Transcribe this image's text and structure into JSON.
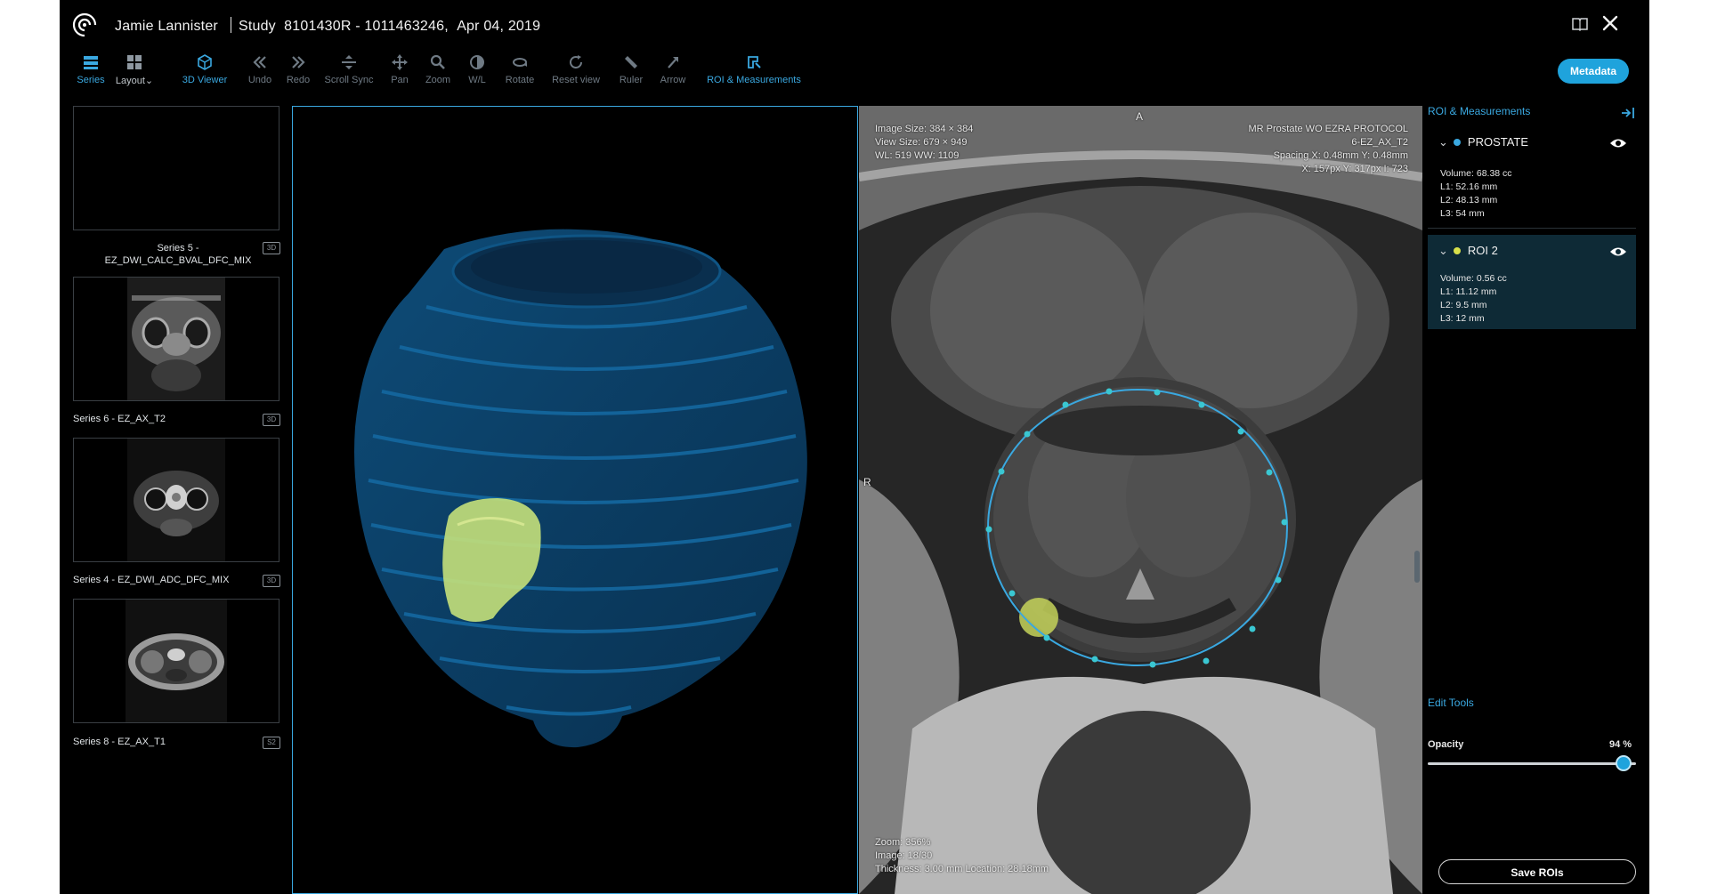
{
  "header": {
    "patient_name": "Jamie Lannister",
    "study_label": "Study",
    "study_id": "8101430R - 1011463246,",
    "study_date": "Apr 04, 2019"
  },
  "toolbar": {
    "items": [
      {
        "label": "Series",
        "icon": "series-icon",
        "active": true
      },
      {
        "label": "Layout",
        "icon": "layout-icon",
        "active": false
      },
      {
        "label": "3D Viewer",
        "icon": "3d-viewer-icon",
        "active": true
      },
      {
        "label": "Undo",
        "icon": "undo-icon",
        "active": false
      },
      {
        "label": "Redo",
        "icon": "redo-icon",
        "active": false
      },
      {
        "label": "Scroll Sync",
        "icon": "scroll-sync-icon",
        "active": false
      },
      {
        "label": "Pan",
        "icon": "pan-icon",
        "active": false
      },
      {
        "label": "Zoom",
        "icon": "zoom-icon",
        "active": false
      },
      {
        "label": "W/L",
        "icon": "window-level-icon",
        "active": false
      },
      {
        "label": "Rotate",
        "icon": "rotate-icon",
        "active": false
      },
      {
        "label": "Reset view",
        "icon": "reset-view-icon",
        "active": false
      },
      {
        "label": "Ruler",
        "icon": "ruler-icon",
        "active": false
      },
      {
        "label": "Arrow",
        "icon": "arrow-icon",
        "active": false
      },
      {
        "label": "ROI & Measurements",
        "icon": "roi-measurements-icon",
        "active": true
      }
    ],
    "layout_caret": "⌄",
    "metadata_label": "Metadata"
  },
  "series_list": [
    {
      "label": "Series 5 - EZ_DWI_CALC_BVAL_DFC_MIX",
      "badge": "3D"
    },
    {
      "label": "Series 6 - EZ_AX_T2",
      "badge": "3D"
    },
    {
      "label": "Series 4 - EZ_DWI_ADC_DFC_MIX",
      "badge": "3D"
    },
    {
      "label": "Series 8 - EZ_AX_T1",
      "badge": "S2"
    }
  ],
  "viewer2d": {
    "top_left": [
      "Image Size: 384 × 384",
      "View Size: 679 × 949",
      "WL: 519 WW: 1109"
    ],
    "top_right": [
      "MR Prostate WO EZRA PROTOCOL",
      "6-EZ_AX_T2",
      "Spacing X: 0.48mm Y: 0.48mm",
      "X: 157px Y: 317px I: 723"
    ],
    "bottom_left": [
      "Zoom: 356%",
      "Image: 18/30",
      "Thickness: 3.00 mm Location: 28.18mm"
    ],
    "orientation_top": "A",
    "orientation_left": "R"
  },
  "panel": {
    "title": "ROI & Measurements",
    "rois": [
      {
        "name": "PROSTATE",
        "color": "#3aa8e0",
        "chevron": "⌄",
        "measurements": [
          "Volume: 68.38 cc",
          "L1: 52.16 mm",
          "L2: 48.13 mm",
          "L3: 54 mm"
        ]
      },
      {
        "name": "ROI 2",
        "color": "#d8e04a",
        "chevron": "⌄",
        "measurements": [
          "Volume: 0.56 cc",
          "L1: 11.12 mm",
          "L2: 9.5 mm",
          "L3: 12 mm"
        ]
      }
    ],
    "edit_tools_label": "Edit Tools",
    "opacity_label": "Opacity",
    "opacity_value": "94 %",
    "opacity_fraction": 0.94,
    "save_label": "Save ROIs"
  },
  "colors": {
    "accent": "#3aa8e0",
    "roi_prostate": "#2f8cc9",
    "roi_lesion": "#c9e05a"
  }
}
